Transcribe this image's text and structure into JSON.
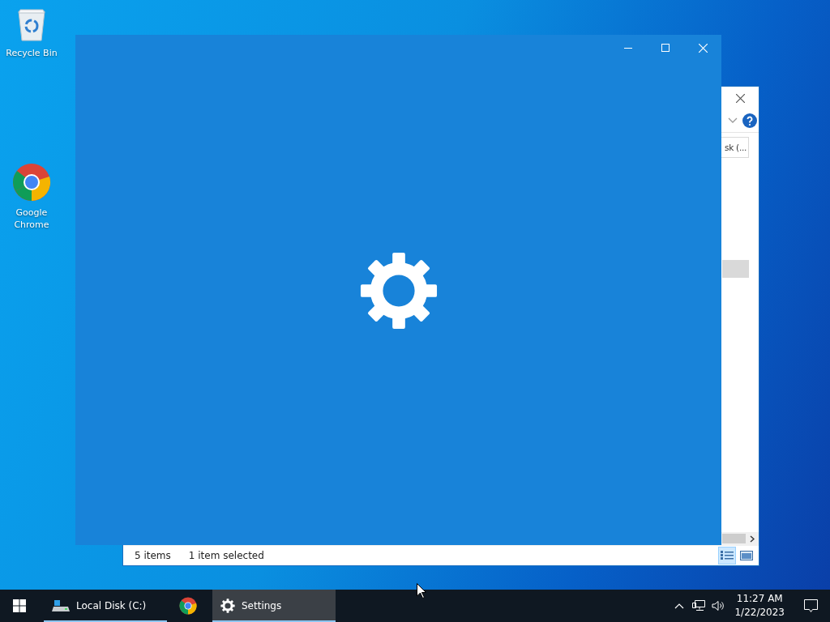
{
  "desktop": {
    "icons": [
      {
        "kind": "recycle-bin",
        "label": "Recycle Bin"
      },
      {
        "kind": "chrome",
        "label": "Google Chrome"
      }
    ]
  },
  "explorer": {
    "search": {
      "value": "sk (..."
    },
    "status": {
      "count": "5 items",
      "selection": "1 item selected"
    },
    "views": [
      {
        "kind": "details",
        "selected": true
      },
      {
        "kind": "tiles",
        "selected": false
      }
    ]
  },
  "taskbar": {
    "apps": [
      {
        "kind": "drive",
        "label": "Local Disk (C:)",
        "running": true,
        "selected": false
      },
      {
        "kind": "chrome",
        "running": false,
        "selected": false
      },
      {
        "kind": "gear",
        "label": "Settings",
        "running": true,
        "selected": true
      }
    ]
  },
  "tray": {
    "time": "11:27 AM",
    "date": "1/22/2023"
  }
}
